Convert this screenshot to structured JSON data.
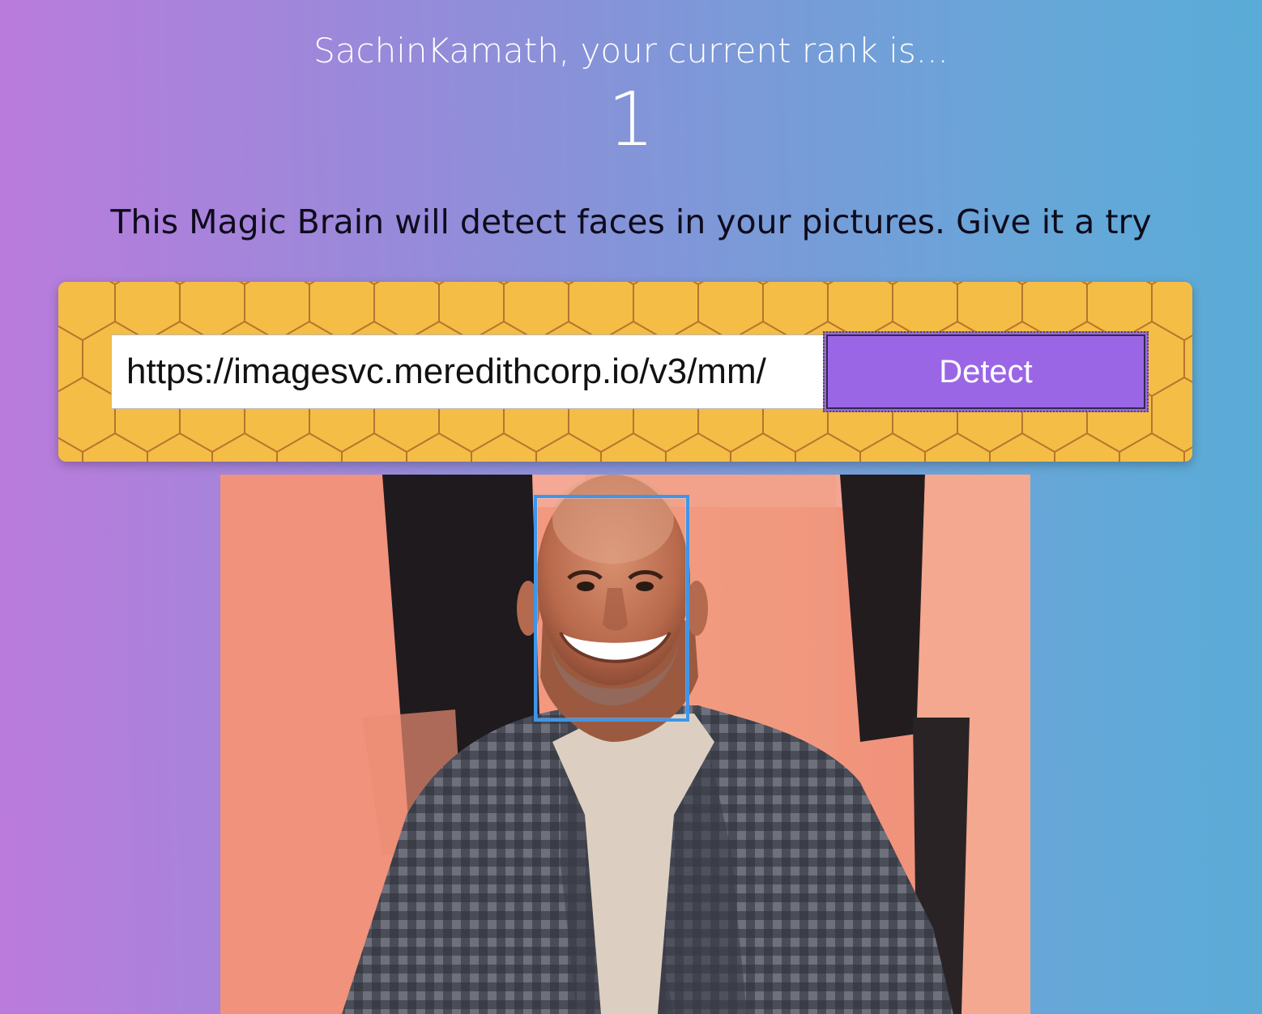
{
  "header": {
    "greeting": "SachinKamath, your current rank is...",
    "rank": "1"
  },
  "tagline": "This Magic Brain will detect faces in your pictures. Give it a try",
  "image_form": {
    "url_value": "https://imagesvc.meredithcorp.io/v3/mm/",
    "detect_label": "Detect"
  },
  "result": {
    "faces_detected": 1
  },
  "colors": {
    "panel_background": "#f4bd45",
    "honeycomb_lines": "#b8742f",
    "detect_button": "#9b66e6",
    "face_box": "#3e96ea"
  },
  "icons": {
    "panel_pattern": "honeycomb-pattern"
  }
}
